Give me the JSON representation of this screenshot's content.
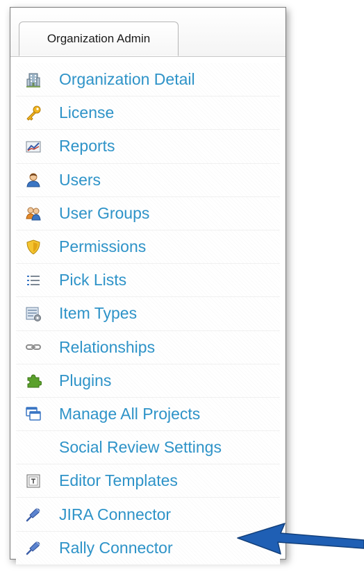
{
  "tab": {
    "label": "Organization Admin"
  },
  "menu": {
    "items": [
      {
        "label": "Organization Detail",
        "icon": "building-icon"
      },
      {
        "label": "License",
        "icon": "key-icon"
      },
      {
        "label": "Reports",
        "icon": "chart-icon"
      },
      {
        "label": "Users",
        "icon": "user-icon"
      },
      {
        "label": "User Groups",
        "icon": "user-group-icon"
      },
      {
        "label": "Permissions",
        "icon": "shield-icon"
      },
      {
        "label": "Pick Lists",
        "icon": "list-icon"
      },
      {
        "label": "Item Types",
        "icon": "item-types-icon"
      },
      {
        "label": "Relationships",
        "icon": "link-icon"
      },
      {
        "label": "Plugins",
        "icon": "puzzle-icon"
      },
      {
        "label": "Manage All Projects",
        "icon": "windows-icon"
      },
      {
        "label": "Social Review Settings",
        "icon": ""
      },
      {
        "label": "Editor Templates",
        "icon": "template-icon"
      },
      {
        "label": "JIRA Connector",
        "icon": "connector-plug-icon"
      },
      {
        "label": "Rally Connector",
        "icon": "connector-plug-icon"
      }
    ]
  },
  "colors": {
    "link": "#2e93c8",
    "arrow": "#1f5fb4"
  }
}
